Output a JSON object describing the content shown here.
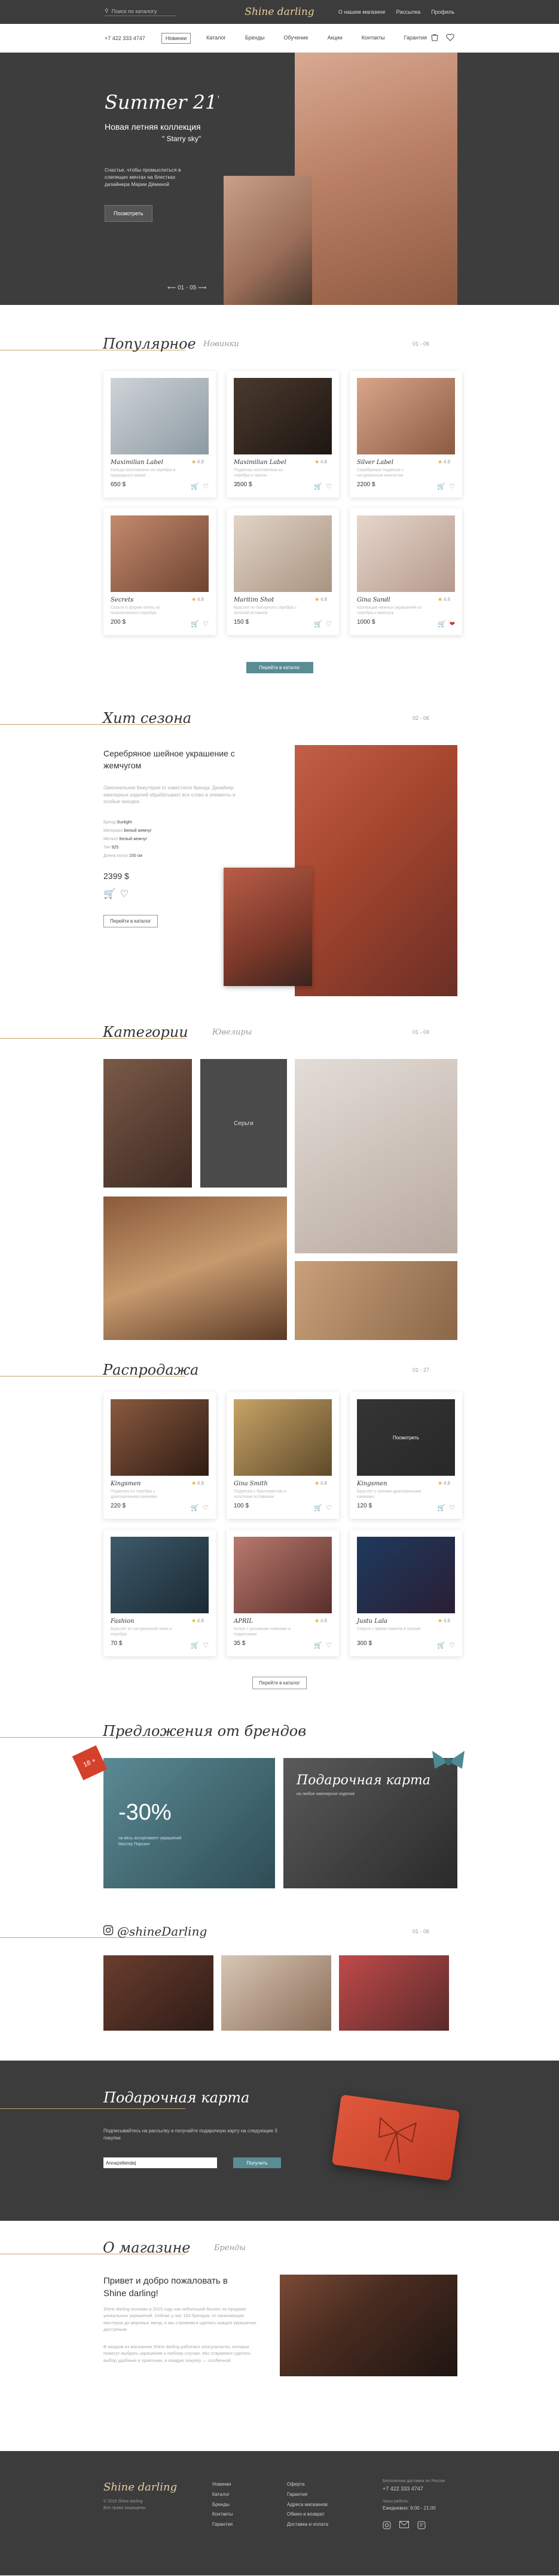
{
  "header": {
    "search_placeholder": "Поиск по каталогу",
    "logo": "Shine darling",
    "top_links": [
      "О нашем магазине",
      "Рассылка",
      "Профиль"
    ],
    "phone": "+7 422 333 4747",
    "menu": [
      "Новинки",
      "Каталог",
      "Бренды",
      "Обучение",
      "Акции",
      "Контакты",
      "Гарантия"
    ],
    "active_menu": "Новинки"
  },
  "hero": {
    "title": "Summer 21",
    "title_sup": "'",
    "subtitle": "Новая летняя коллекция",
    "subtitle2": "\" Starry sky\"",
    "desc": "Счастье, чтобы промыслиться в слепящих мечтах на блестках дизайнера Марии Дёминой",
    "button": "Посмотреть",
    "pager": "01 - 05"
  },
  "popular": {
    "title": "Популярное",
    "tab": "Новинки",
    "pager": "01 - 06",
    "cards": [
      {
        "name": "Maximilian Label",
        "rating": "4.8",
        "desc": "Кольцо изготовлено из серебра и природного камня",
        "price": "650 $"
      },
      {
        "name": "Maximilian Label",
        "rating": "4.8",
        "desc": "Подвеска изготовлена из серебра и эмали",
        "price": "3500 $"
      },
      {
        "name": "Silver Label",
        "rating": "4.9",
        "desc": "Серебряные подвески с натуральным жемчугом",
        "price": "2200 $"
      },
      {
        "name": "Secrets",
        "rating": "4.8",
        "desc": "Серьги в форме колец из позолоченного серебра",
        "price": "200 $"
      },
      {
        "name": "Maritim Shot",
        "rating": "4.8",
        "desc": "Браслет из бисерного серебра с золотой вставкой",
        "price": "150 $"
      },
      {
        "name": "Gina Sandl",
        "rating": "4.6",
        "desc": "Коллекция нежных украшений из серебра и жемчуга",
        "price": "1000 $"
      }
    ],
    "button": "Перейти в каталог"
  },
  "hit": {
    "title": "Хит сезона",
    "pager": "02 - 06",
    "heading": "Серебряное шейное украшение с жемчугом",
    "desc": "Оригинальная бижутерия от известного бренда. Дизайнер ювелирных изделий обрабатывает все слово в элементы и особые находки.",
    "props": [
      {
        "k": "Бренд",
        "v": "Sunlight"
      },
      {
        "k": "Материал",
        "v": "Белый жемчуг"
      },
      {
        "k": "Металл",
        "v": "Белый жемчуг"
      },
      {
        "k": "Тип",
        "v": "925"
      },
      {
        "k": "Длина колье",
        "v": "150 см"
      }
    ],
    "price": "2399 $",
    "button": "Перейти в каталог"
  },
  "categories": {
    "title": "Категории",
    "tab": "Ювелиры",
    "pager": "01 - 04",
    "overlay_label": "Серьги"
  },
  "sale": {
    "title": "Распродажа",
    "pager": "01 - 27",
    "cards": [
      {
        "name": "Kingsmen",
        "rating": "4.8",
        "desc": "Подвеска из серебра с драгоценными камнями",
        "price": "220 $",
        "overlay": ""
      },
      {
        "name": "Gina Smith",
        "rating": "4.8",
        "desc": "Подвеска с бриллиантом и золотыми вставками",
        "price": "100 $",
        "overlay": ""
      },
      {
        "name": "Kingsmen",
        "rating": "4.8",
        "desc": "Браслет с синими драгоценными камнями",
        "price": "120 $",
        "overlay": "Посмотреть"
      },
      {
        "name": "Fashion",
        "rating": "4.8",
        "desc": "Браслет из натуральной кожи и серебра",
        "price": "70 $",
        "overlay": ""
      },
      {
        "name": "APRIL",
        "rating": "4.8",
        "desc": "Колье с розовыми камнями и подвесками",
        "price": "35 $",
        "overlay": ""
      },
      {
        "name": "Justu Lala",
        "rating": "4.8",
        "desc": "Серьги с ярким камнем в оправе",
        "price": "300 $",
        "overlay": ""
      }
    ],
    "button": "Перейти в каталог"
  },
  "offers": {
    "title": "Предложения от брендов",
    "badge": "18 +",
    "discount": "-30%",
    "discount_desc": "на весь ассортимент украшений Мистер Пирсинг",
    "gift_title": "Подарочная карта",
    "gift_sub": "на любое ювелирное изделие"
  },
  "insta": {
    "title": "@shineDarling",
    "pager": "01 - 06"
  },
  "gift": {
    "title": "Подарочная карта",
    "desc": "Подписывайтесь на рассылку и получайте подарочную карту на следующие 3 покупки",
    "input_value": "Annazellenda|",
    "button": "Получить"
  },
  "about": {
    "title": "О магазине",
    "tab": "Бренды",
    "heading": "Привет и добро пожаловать в Shine darling!",
    "p1": "Shine darling основан в 2015 году как небольшой бизнес по продаже уникальных украшений. Сейчас у нас 150 брендов, от начинающих мастеров до мировых звезд, и мы стремимся сделать каждое украшение доступным.",
    "p2": "В каждом из магазинов Shine darling работают консультанты, которые помогут выбрать украшение к любому случаю. Мы стараемся сделать выбор удобным и приятным, а каждую покупку — особенной."
  },
  "footer": {
    "logo": "Shine darling",
    "copy": "© 2015 Shine darling\nВсе права защищены",
    "col1": [
      "Новинки",
      "Каталог",
      "Бренды",
      "Контакты",
      "Гарантия"
    ],
    "col2": [
      "Оферта",
      "Гарантия",
      "Адреса магазинов",
      "Обмен и возврат",
      "Доставка и оплата"
    ],
    "contact_title": "Бесплатная доставка по России",
    "phone": "+7 422 333 4747",
    "hours_title": "Часы работы",
    "hours": "Ежедневно: 9:00 - 21:00"
  },
  "colors": {
    "dark": "#3c3c3c",
    "gold": "#c8a46b",
    "teal": "#5a8c95",
    "accent_red": "#c23e27"
  }
}
